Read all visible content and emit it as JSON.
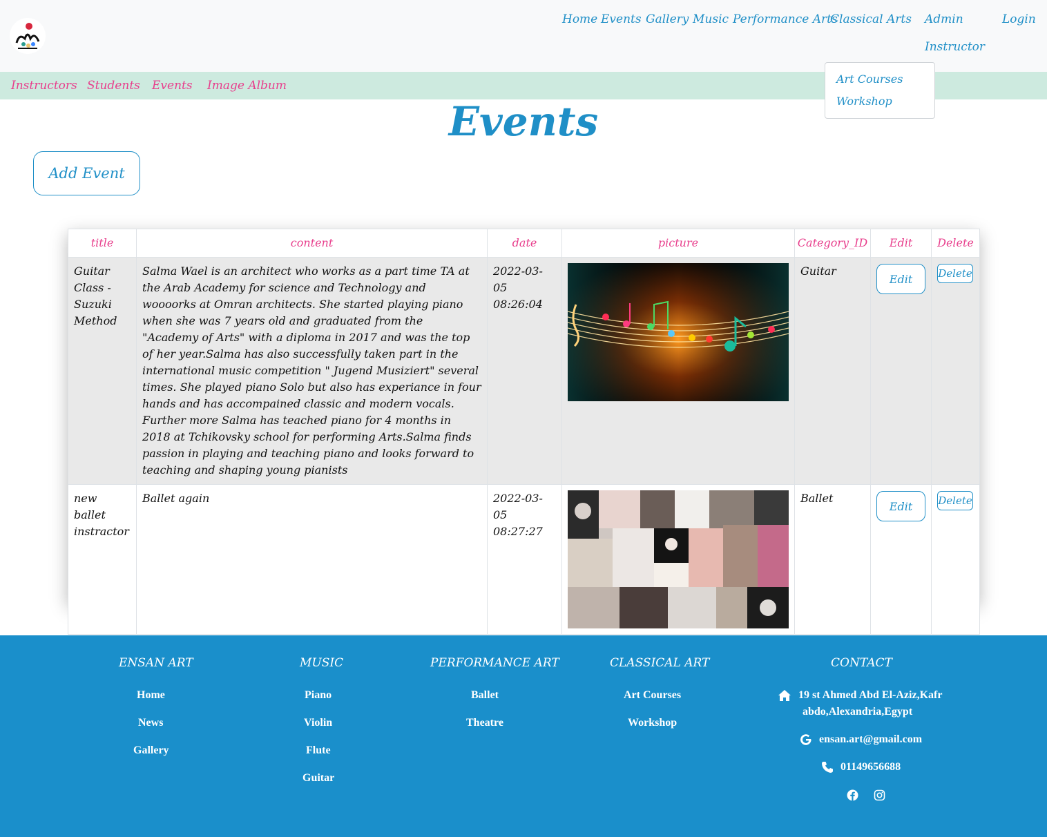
{
  "nav": {
    "home": "Home",
    "events": "Events",
    "gallery": "Gallery",
    "music": "Music",
    "performance_arts": "Performance Arts",
    "classical_arts": "Classical Arts",
    "admin": "Admin",
    "instructor": "Instructor",
    "login": "Login"
  },
  "dropdown": {
    "items": [
      "Art Courses",
      "Workshop"
    ]
  },
  "subnav": {
    "items": [
      "Instructors",
      "Students",
      "Events",
      "Image Album"
    ]
  },
  "page": {
    "title": "Events",
    "add_button": "Add Event"
  },
  "table": {
    "headers": [
      "title",
      "content",
      "date",
      "picture",
      "Category_ID",
      "Edit",
      "Delete"
    ],
    "rows": [
      {
        "title": "Guitar Class - Suzuki Method",
        "content": "Salma Wael is an architect who works as a part time TA at the Arab Academy for science and Technology and woooorks at Omran architects. She started playing piano when she was 7 years old and graduated from the \"Academy of Arts\" with a diploma in 2017 and was the top of her year.Salma has also successfully taken part in the international music competition \" Jugend Musiziert\" several times. She played piano Solo but also has experiance in four hands and has accompained classic and modern vocals. Further more Salma has teached piano for 4 months in 2018 at Tchikovsky school for performing Arts.Salma finds passion in playing and teaching piano and looks forward to teaching and shaping young pianists",
        "date": "2022-03-05 08:26:04",
        "category": "Guitar",
        "edit": "Edit",
        "delete": "Delete"
      },
      {
        "title": "new ballet instractor",
        "content": "Ballet again",
        "date": "2022-03-05 08:27:27",
        "category": "Ballet",
        "edit": "Edit",
        "delete": "Delete"
      }
    ]
  },
  "footer": {
    "col1": {
      "heading": "ENSAN ART",
      "links": [
        "Home",
        "News",
        "Gallery"
      ]
    },
    "col2": {
      "heading": "MUSIC",
      "links": [
        "Piano",
        "Violin",
        "Flute",
        "Guitar"
      ]
    },
    "col3": {
      "heading": "PERFORMANCE ART",
      "links": [
        "Ballet",
        "Theatre"
      ]
    },
    "col4": {
      "heading": "CLASSICAL ART",
      "links": [
        "Art Courses",
        "Workshop"
      ]
    },
    "contact": {
      "heading": "CONTACT",
      "address_line1": "19 st Ahmed Abd El-Aziz,Kafr",
      "address_line2": "abdo,Alexandria,Egypt",
      "email": "ensan.art@gmail.com",
      "phone": "01149656688"
    }
  },
  "colors": {
    "accent_blue": "#1f8fc7",
    "pink": "#e83e8c",
    "subnav_bg": "#cdeadf",
    "footer_bg": "#1a8fcb"
  }
}
